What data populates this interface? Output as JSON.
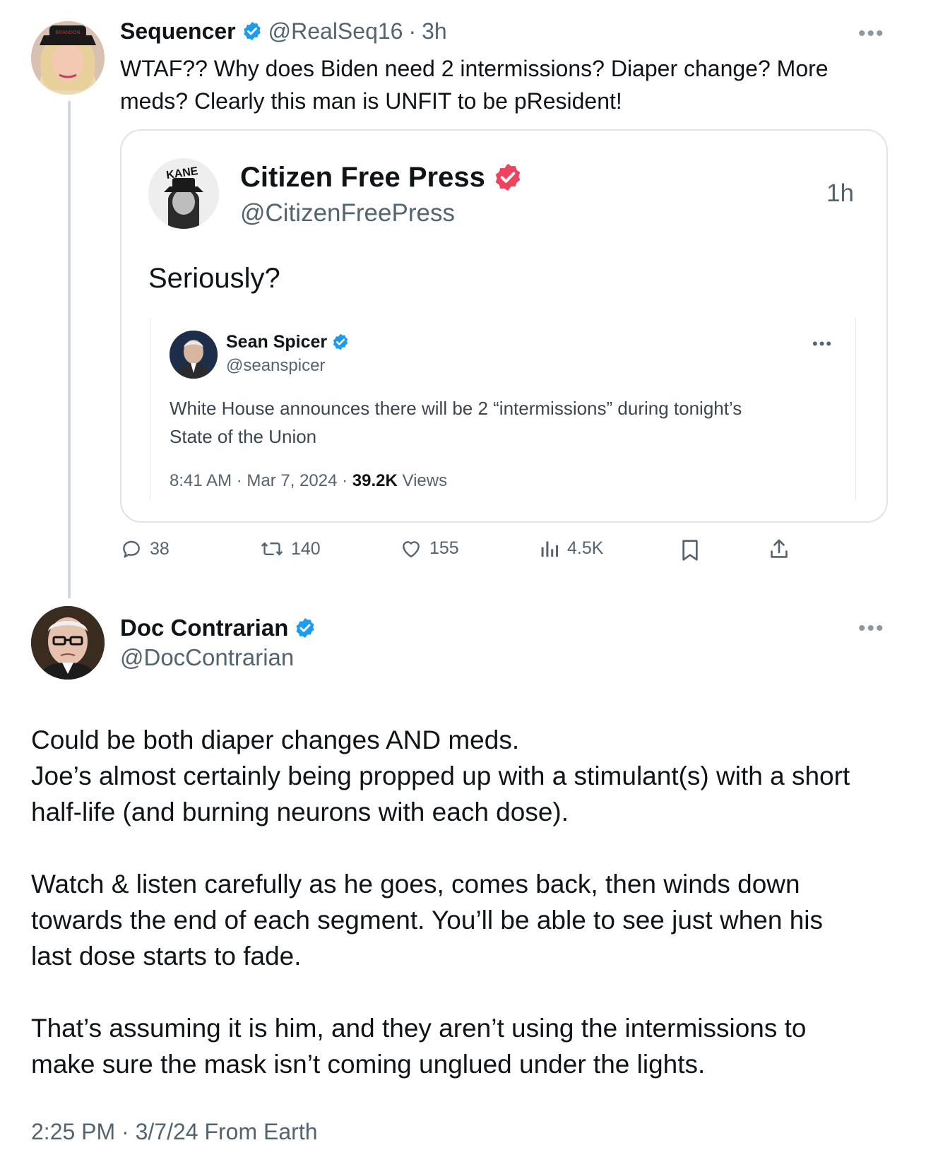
{
  "tweet1": {
    "display_name": "Sequencer",
    "handle": "@RealSeq16",
    "separator": "·",
    "time": "3h",
    "text_line1": "WTAF??  Why does Biden need 2 intermissions?  Diaper change? More",
    "text_line2": "meds? Clearly this man is UNFIT to be pResident!",
    "avatar_hat_text": "BRANDON",
    "quote": {
      "avatar_text": "KANE",
      "display_name": "Citizen Free Press",
      "handle": "@CitizenFreePress",
      "time": "1h",
      "text": "Seriously?",
      "embedded": {
        "display_name": "Sean Spicer",
        "handle": "@seanspicer",
        "text_line1": "White House announces there will be 2 “intermissions” during tonight’s",
        "text_line2": "State of the Union",
        "timestamp": "8:41 AM · Mar 7, 2024 · ",
        "views_count": "39.2K",
        "views_label": " Views"
      }
    },
    "actions": {
      "replies": "38",
      "reposts": "140",
      "likes": "155",
      "views": "4.5K"
    }
  },
  "tweet2": {
    "display_name": "Doc Contrarian",
    "handle": "@DocContrarian",
    "para1_line1": "Could be both diaper changes AND meds.",
    "para1_line2": "Joe’s almost certainly being propped up with a stimulant(s) with a short",
    "para1_line3": "half-life (and burning neurons with each dose).",
    "para2_line1": "Watch & listen carefully as he goes, comes back, then winds down",
    "para2_line2": "towards the end of each segment. You’ll be able to see just when his",
    "para2_line3": "last dose starts to fade.",
    "para3_line1": "That’s assuming it is him, and they aren’t using the intermissions to",
    "para3_line2": "make sure the mask isn’t coming unglued under the lights.",
    "footer": "2:25 PM · 3/7/24 From Earth"
  },
  "colors": {
    "verified_blue": "#1d9bf0",
    "verified_gold_red": "#f0415d",
    "muted_text": "#536471",
    "border": "#dfe4e8"
  },
  "icons": [
    "more-icon",
    "verified-badge-icon",
    "reply-icon",
    "repost-icon",
    "like-icon",
    "views-icon",
    "bookmark-icon",
    "share-icon"
  ]
}
